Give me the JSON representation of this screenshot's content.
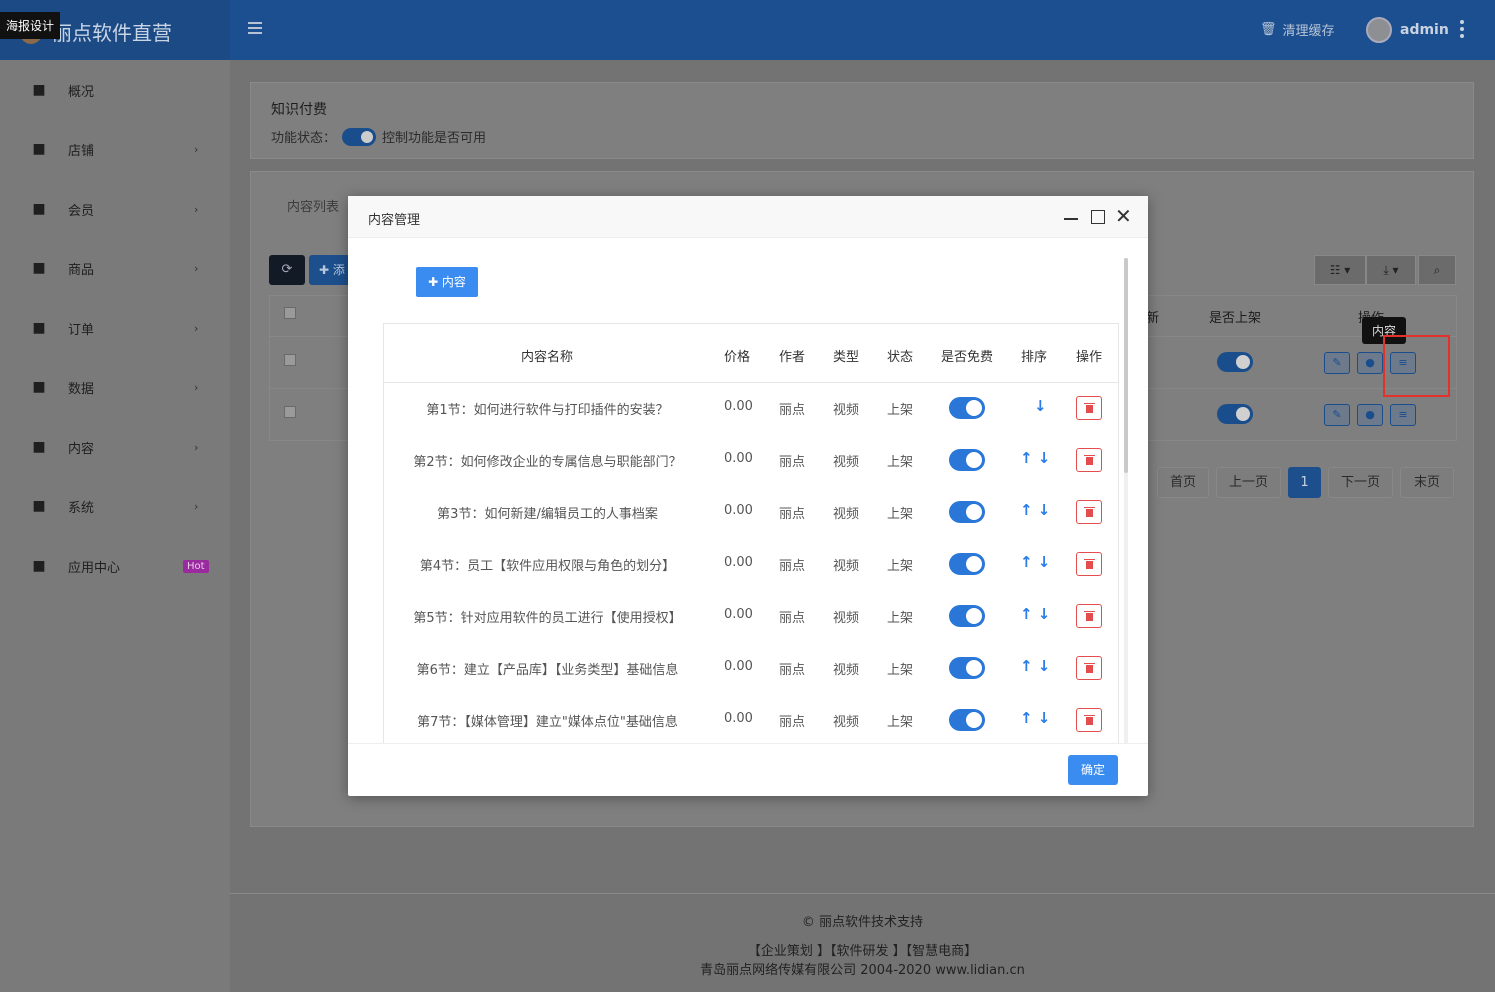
{
  "topbar": {
    "brand": "丽点软件直营",
    "poster_tip": "海报设计",
    "clear_cache": "清理缓存",
    "user": "admin"
  },
  "sidebar": {
    "items": [
      {
        "label": "概况",
        "icon": "dashboard-icon",
        "chevron": ""
      },
      {
        "label": "店铺",
        "icon": "grid-icon",
        "chevron": "›"
      },
      {
        "label": "会员",
        "icon": "users-icon",
        "chevron": "›"
      },
      {
        "label": "商品",
        "icon": "cart-icon",
        "chevron": "›"
      },
      {
        "label": "订单",
        "icon": "money-icon",
        "chevron": "›"
      },
      {
        "label": "数据",
        "icon": "chart-icon",
        "chevron": "›"
      },
      {
        "label": "内容",
        "icon": "file-icon",
        "chevron": "›"
      },
      {
        "label": "系统",
        "icon": "gear-icon",
        "chevron": "›"
      },
      {
        "label": "应用中心",
        "icon": "cube-icon",
        "chevron": ""
      }
    ],
    "hot_badge": "Hot"
  },
  "feature": {
    "title": "知识付费",
    "status_label": "功能状态：",
    "status_desc": "控制功能是否可用",
    "enabled": true
  },
  "list_panel": {
    "tab": "内容列表",
    "add_label": "✚ 添",
    "headers": {
      "new": "新",
      "on_shelf": "是否上架",
      "action": "操作"
    },
    "tooltip": "内容",
    "pager": {
      "first": "首页",
      "prev": "上一页",
      "current": "1",
      "next": "下一页",
      "last": "末页"
    }
  },
  "footer": {
    "support": "© 丽点软件技术支持",
    "links": "【企业策划 】【软件研发 】【智慧电商】",
    "company": "青岛丽点网络传媒有限公司 2004-2020 www.lidian.cn"
  },
  "modal": {
    "title": "内容管理",
    "add_button": "✚ 内容",
    "columns": {
      "name": "内容名称",
      "price": "价格",
      "author": "作者",
      "type": "类型",
      "status": "状态",
      "free": "是否免费",
      "sort": "排序",
      "action": "操作"
    },
    "rows": [
      {
        "name": "第1节：如何进行软件与打印插件的安装？",
        "price": "0.00",
        "author": "丽点",
        "type": "视频",
        "status": "上架",
        "free": true,
        "sort": "↓"
      },
      {
        "name": "第2节：如何修改企业的专属信息与职能部门？",
        "price": "0.00",
        "author": "丽点",
        "type": "视频",
        "status": "上架",
        "free": true,
        "sort": "↑ ↓"
      },
      {
        "name": "第3节：如何新建/编辑员工的人事档案",
        "price": "0.00",
        "author": "丽点",
        "type": "视频",
        "status": "上架",
        "free": true,
        "sort": "↑ ↓"
      },
      {
        "name": "第4节：员工【软件应用权限与角色的划分】",
        "price": "0.00",
        "author": "丽点",
        "type": "视频",
        "status": "上架",
        "free": true,
        "sort": "↑ ↓"
      },
      {
        "name": "第5节：针对应用软件的员工进行【使用授权】",
        "price": "0.00",
        "author": "丽点",
        "type": "视频",
        "status": "上架",
        "free": true,
        "sort": "↑ ↓"
      },
      {
        "name": "第6节：建立【产品库】【业务类型】基础信息",
        "price": "0.00",
        "author": "丽点",
        "type": "视频",
        "status": "上架",
        "free": true,
        "sort": "↑ ↓"
      },
      {
        "name": "第7节：【媒体管理】建立\"媒体点位\"基础信息",
        "price": "0.00",
        "author": "丽点",
        "type": "视频",
        "status": "上架",
        "free": true,
        "sort": "↑ ↓"
      }
    ],
    "ok_button": "确定"
  }
}
